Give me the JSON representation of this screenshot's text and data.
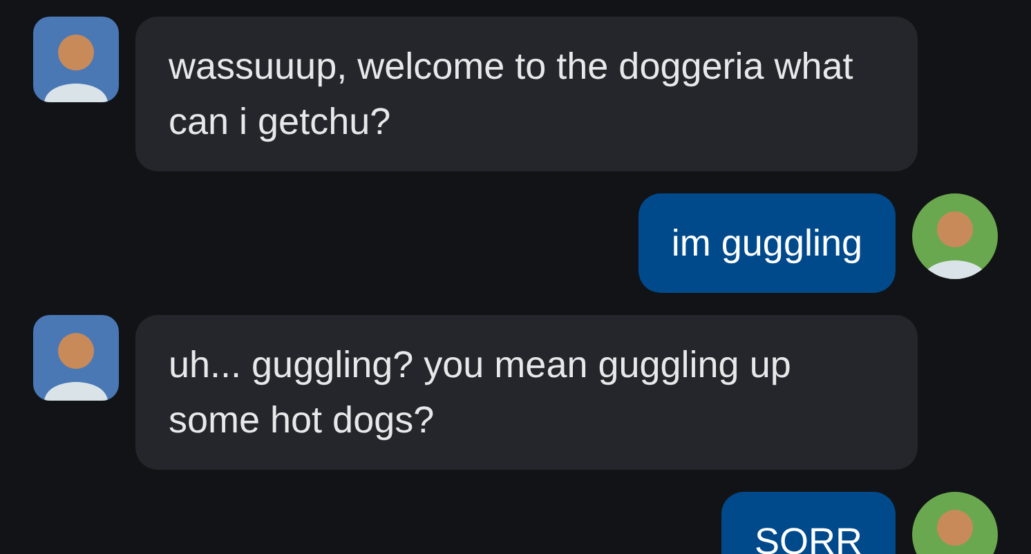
{
  "messages": [
    {
      "kind": "received",
      "text": "wassuuup, welcome to the doggeria what can i getchu?"
    },
    {
      "kind": "sent",
      "text": "im guggling"
    },
    {
      "kind": "received",
      "text": "uh... guggling? you mean guggling up some hot dogs?"
    },
    {
      "kind": "sent",
      "text": "SORR"
    }
  ]
}
